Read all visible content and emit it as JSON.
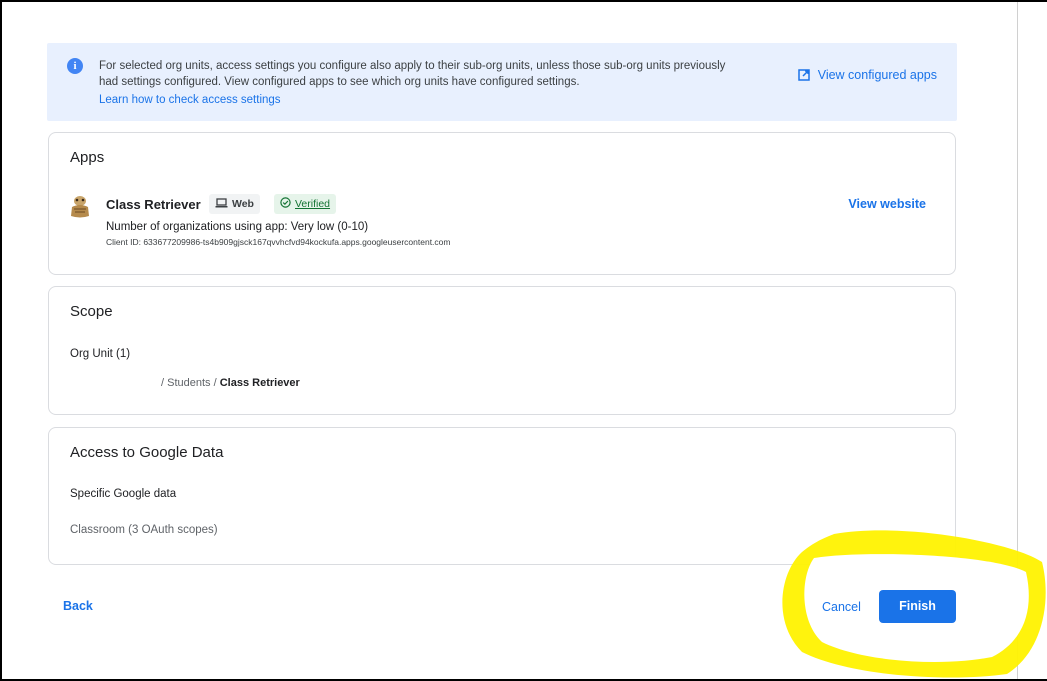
{
  "banner": {
    "text": "For selected org units, access settings you configure also apply to their sub-org units, unless those sub-org units previously had settings configured. View configured apps to see which org units have configured settings.",
    "link": "Learn how to check access settings",
    "view_configured": "View configured apps",
    "info_icon": "info-icon",
    "open_icon": "open-in-new-icon"
  },
  "apps": {
    "title": "Apps",
    "name": "Class Retriever",
    "chip_web": "Web",
    "chip_verified": "Verified",
    "orgs_using": "Number of organizations using app: Very low (0-10)",
    "client_id": "Client ID: 633677209986-ts4b909gjsck167qvvhcfvd94kockufa.apps.googleusercontent.com",
    "view_website": "View website"
  },
  "scope": {
    "title": "Scope",
    "org_unit": "Org Unit (1)",
    "path_prefix": "/ Students /",
    "path_leaf": "Class Retriever"
  },
  "access": {
    "title": "Access to Google Data",
    "label": "Specific Google data",
    "sub": "Classroom (3 OAuth scopes)"
  },
  "footer": {
    "back": "Back",
    "cancel": "Cancel",
    "finish": "Finish"
  },
  "colors": {
    "accent": "#1a73e8",
    "banner_bg": "#e8f0fe",
    "highlight": "#fff200"
  }
}
